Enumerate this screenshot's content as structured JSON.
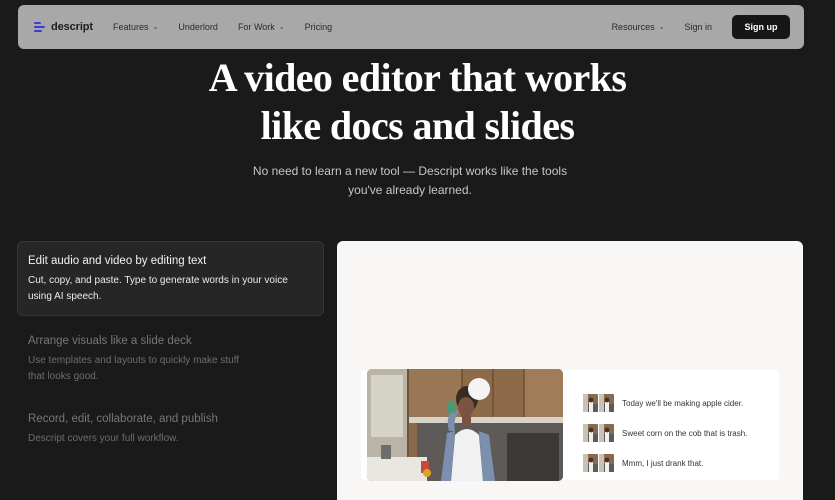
{
  "nav": {
    "logo": "descript",
    "items": [
      {
        "label": "Features",
        "dropdown": true
      },
      {
        "label": "Underlord",
        "dropdown": false
      },
      {
        "label": "For Work",
        "dropdown": true
      },
      {
        "label": "Pricing",
        "dropdown": false
      }
    ],
    "resources": "Resources",
    "signin": "Sign in",
    "signup": "Sign up"
  },
  "hero": {
    "title_line1": "A video editor that works",
    "title_line2": "like docs and slides",
    "sub_line1": "No need to learn a new tool — Descript works like the tools",
    "sub_line2": "you've already learned."
  },
  "features": [
    {
      "title": "Edit audio and video by editing text",
      "desc_line1": "Cut, copy, and paste. Type to generate words in your voice",
      "desc_line2": "using AI speech.",
      "active": true
    },
    {
      "title": "Arrange visuals like a slide deck",
      "desc_line1": "Use templates and layouts to quickly make stuff",
      "desc_line2": "that looks good.",
      "active": false
    },
    {
      "title": "Record, edit, collaborate, and publish",
      "desc_line1": "Descript covers your full workflow.",
      "desc_line2": "",
      "active": false
    }
  ],
  "transcript": [
    "Today we'll be making apple cider.",
    "Sweet corn on the cob that is trash.",
    "Mmm, I just drank that."
  ],
  "colors": {
    "background": "#1a1a1a",
    "navbar": "#a8a8a8",
    "brand": "#3b3bd9",
    "signup_bg": "#161616"
  }
}
